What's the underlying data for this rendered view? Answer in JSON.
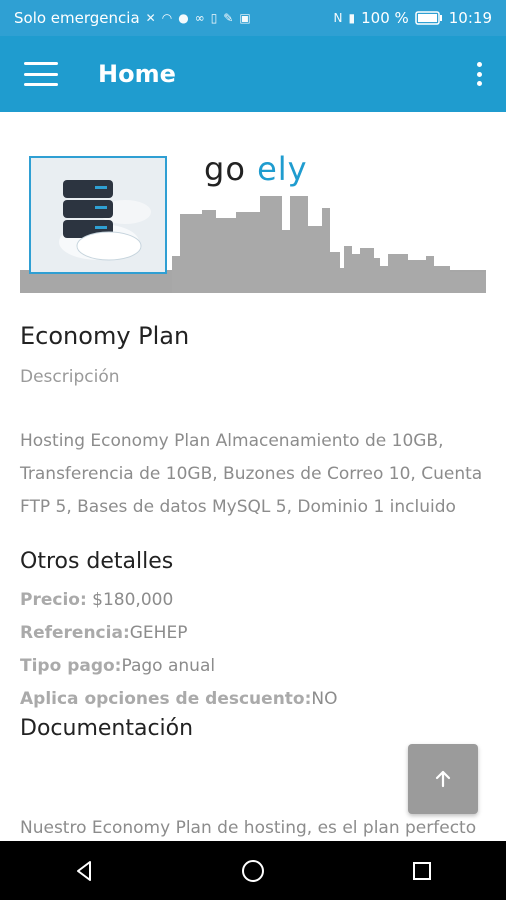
{
  "status_bar": {
    "carrier": "Solo emergencia",
    "battery": "100 %",
    "time": "10:19"
  },
  "app_bar": {
    "title": "Home"
  },
  "banner": {
    "brand_text_1": "go",
    "brand_text_2": "ely"
  },
  "product": {
    "name": "Economy Plan",
    "description_label": "Descripción",
    "description": "Hosting Economy Plan Almacenamiento de 10GB, Transferencia de 10GB, Buzones de Correo 10, Cuenta FTP 5, Bases de datos MySQL 5, Dominio 1 incluido"
  },
  "details": {
    "heading": "Otros detalles",
    "price_label": "Precio:",
    "price_value": "$180,000",
    "ref_label": "Referencia:",
    "ref_value": "GEHEP",
    "pay_label": "Tipo pago:",
    "pay_value": "Pago anual",
    "discount_label": "Aplica opciones de descuento:",
    "discount_value": "NO"
  },
  "documentation": {
    "heading": "Documentación",
    "text": "Nuestro Economy Plan de hosting, es el plan perfecto"
  },
  "colors": {
    "status_bar": "#2fa0d3",
    "app_bar": "#1f9ccf",
    "fab": "#9b9b9b"
  }
}
